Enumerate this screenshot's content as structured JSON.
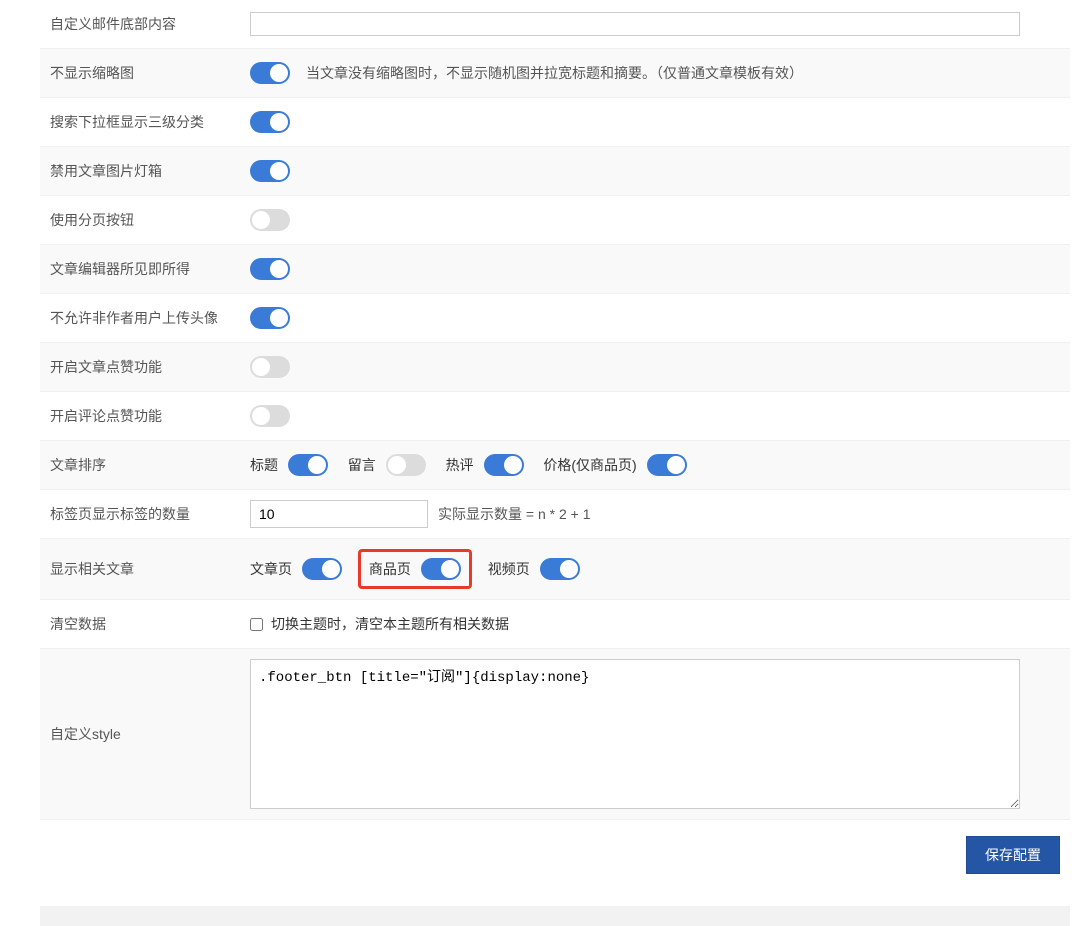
{
  "rows": {
    "r0_label": "自定义邮件底部内容",
    "r1_label": "不显示缩略图",
    "r1_desc": "当文章没有缩略图时，不显示随机图并拉宽标题和摘要。（仅普通文章模板有效）",
    "r2_label": "搜索下拉框显示三级分类",
    "r3_label": "禁用文章图片灯箱",
    "r4_label": "使用分页按钮",
    "r5_label": "文章编辑器所见即所得",
    "r6_label": "不允许非作者用户上传头像",
    "r7_label": "开启文章点赞功能",
    "r8_label": "开启评论点赞功能",
    "r9_label": "文章排序",
    "r10_label": "标签页显示标签的数量",
    "r10_value": "10",
    "r10_desc": "实际显示数量 = n * 2 + 1",
    "r11_label": "显示相关文章",
    "r12_label": "清空数据",
    "r12_desc": "切换主题时，清空本主题所有相关数据",
    "r13_label": "自定义style",
    "r13_value": ".footer_btn [title=\"订阅\"]{display:none}"
  },
  "sort": {
    "title": "标题",
    "comments": "留言",
    "hot": "热评",
    "price": "价格(仅商品页)"
  },
  "related": {
    "article": "文章页",
    "product": "商品页",
    "video": "视频页"
  },
  "save_btn": "保存配置"
}
